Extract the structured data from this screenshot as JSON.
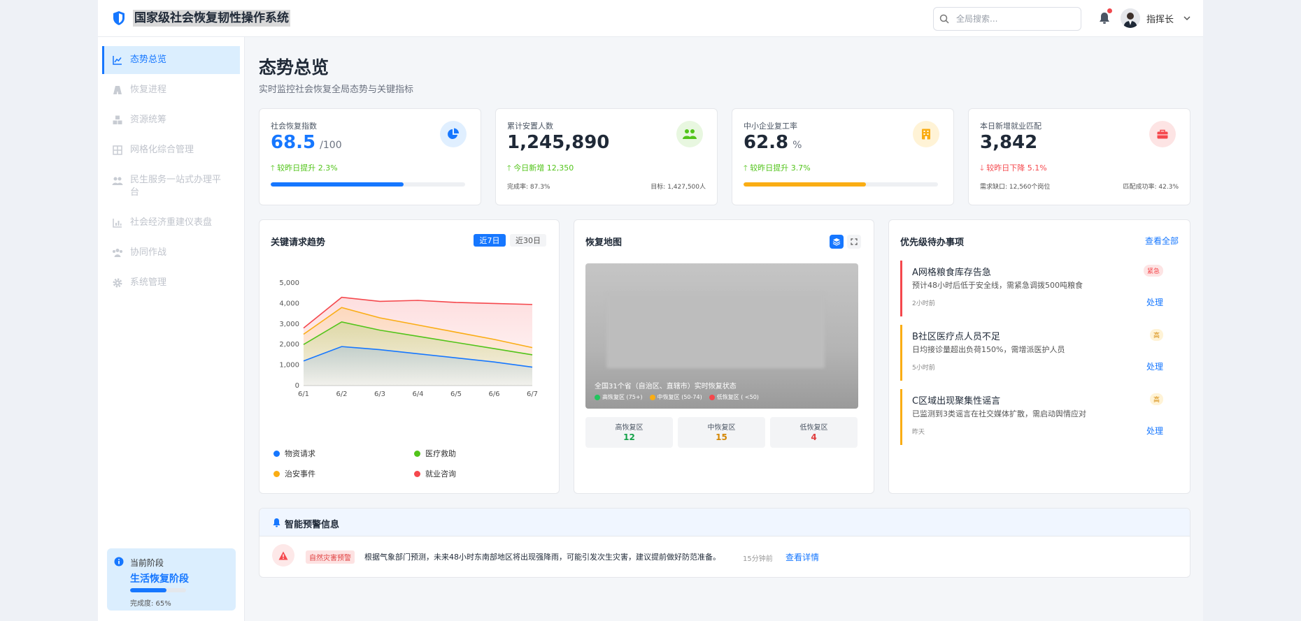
{
  "header": {
    "title": "国家级社会恢复韧性操作系统",
    "search_placeholder": "全局搜索...",
    "user_name": "指挥长"
  },
  "sidebar": {
    "items": [
      {
        "label": "态势总览",
        "active": true,
        "icon": "chart-line-icon"
      },
      {
        "label": "恢复进程",
        "icon": "road-icon"
      },
      {
        "label": "资源统筹",
        "icon": "boxes-icon"
      },
      {
        "label": "网格化综合管理",
        "icon": "grid-icon"
      },
      {
        "label": "民生服务一站式办理平台",
        "icon": "users-icon"
      },
      {
        "label": "社会经济重建仪表盘",
        "icon": "bar-chart-icon"
      },
      {
        "label": "协同作战",
        "icon": "team-icon"
      },
      {
        "label": "系统管理",
        "icon": "gear-icon"
      }
    ],
    "phase": {
      "title": "当前阶段",
      "name": "生活恢复阶段",
      "progress_label": "完成度: 65%",
      "progress": 0.65
    }
  },
  "page": {
    "title": "态势总览",
    "subtitle": "实时监控社会恢复全局态势与关键指标"
  },
  "stats": [
    {
      "label": "社会恢复指数",
      "value": "68.5",
      "unit": "/100",
      "change": "较昨日提升 2.3%",
      "trend": "up",
      "progress": 0.685,
      "color": "#1677ff",
      "icon": "pie-chart-icon"
    },
    {
      "label": "累计安置人数",
      "value": "1,245,890",
      "change": "今日新增 12,350",
      "trend": "up",
      "foot_left": "完成率: 87.3%",
      "foot_right": "目标: 1,427,500人",
      "color": "#52c41a",
      "icon": "users-icon"
    },
    {
      "label": "中小企业复工率",
      "value": "62.8",
      "unit": "%",
      "change": "较昨日提升 3.7%",
      "trend": "up",
      "progress": 0.628,
      "color": "#faad14",
      "icon": "building-icon"
    },
    {
      "label": "本日新增就业匹配",
      "value": "3,842",
      "change": "较昨日下降 5.1%",
      "trend": "down",
      "foot_left": "需求缺口: 12,560个岗位",
      "foot_right": "匹配成功率: 42.3%",
      "color": "#f5484d",
      "icon": "briefcase-icon"
    }
  ],
  "trend_card": {
    "title": "关键请求趋势",
    "range_options": [
      "近7日",
      "近30日"
    ],
    "selected_range": "近7日"
  },
  "chart_data": {
    "type": "area",
    "x": [
      "6/1",
      "6/2",
      "6/3",
      "6/4",
      "6/5",
      "6/6",
      "6/7"
    ],
    "ylim": [
      0,
      5000
    ],
    "yticks": [
      0,
      1000,
      2000,
      3000,
      4000,
      5000
    ],
    "ytick_labels": [
      "0",
      "1,000",
      "2,000",
      "3,000",
      "4,000",
      "5,000"
    ],
    "series": [
      {
        "name": "就业咨询",
        "color": "#f5484d",
        "values": [
          2800,
          4300,
          4100,
          4150,
          4050,
          4000,
          3950
        ]
      },
      {
        "name": "治安事件",
        "color": "#faad14",
        "values": [
          2500,
          3800,
          3300,
          2950,
          2600,
          2250,
          1850
        ]
      },
      {
        "name": "医疗救助",
        "color": "#52c41a",
        "values": [
          2000,
          3100,
          2700,
          2400,
          2100,
          1800,
          1500
        ]
      },
      {
        "name": "物资请求",
        "color": "#1677ff",
        "values": [
          1200,
          1900,
          1750,
          1550,
          1350,
          1150,
          900
        ]
      }
    ],
    "legend": [
      "物资请求",
      "医疗救助",
      "治安事件",
      "就业咨询"
    ],
    "legend_position": "bottom",
    "grid": false
  },
  "map_card": {
    "title": "恢复地图",
    "caption": "全国31个省（自治区、直辖市）实时恢复状态",
    "legend": [
      {
        "label": "高恢复区 (75+)",
        "color": "#22c55e"
      },
      {
        "label": "中恢复区 (50-74)",
        "color": "#faad14"
      },
      {
        "label": "低恢复区 ( <50)",
        "color": "#f5484d"
      }
    ],
    "regions": [
      {
        "label": "高恢复区",
        "value": "12",
        "color": "#16a34a"
      },
      {
        "label": "中恢复区",
        "value": "15",
        "color": "#d48806"
      },
      {
        "label": "低恢复区",
        "value": "4",
        "color": "#e03e3e"
      }
    ]
  },
  "todo_card": {
    "title": "优先级待办事项",
    "view_all": "查看全部",
    "items": [
      {
        "title": "A网格粮食库存告急",
        "desc": "预计48小时后低于安全线，需紧急调拨500吨粮食",
        "time": "2小时前",
        "tag": "紧急",
        "action": "处理",
        "color": "#f5484d"
      },
      {
        "title": "B社区医疗点人员不足",
        "desc": "日均接诊量超出负荷150%，需增派医护人员",
        "time": "5小时前",
        "tag": "高",
        "action": "处理",
        "color": "#faad14"
      },
      {
        "title": "C区域出现聚集性谣言",
        "desc": "已监测到3类谣言在社交媒体扩散，需启动舆情应对",
        "time": "昨天",
        "tag": "高",
        "action": "处理",
        "color": "#faad14"
      }
    ]
  },
  "alerts": {
    "title": "智能预警信息",
    "items": [
      {
        "tag": "自然灾害预警",
        "text": "根据气象部门预测，未来48小时东南部地区将出现强降雨，可能引发次生灾害，建议提前做好防范准备。",
        "time": "15分钟前",
        "link": "查看详情"
      }
    ]
  }
}
